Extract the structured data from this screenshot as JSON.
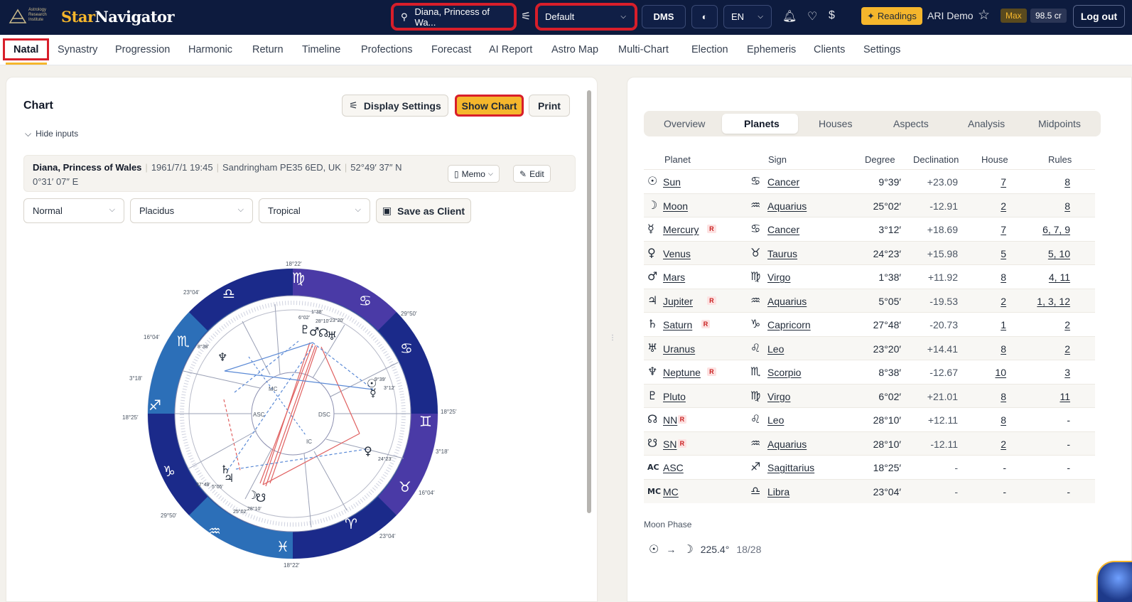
{
  "app": {
    "logo_small": "Astrology Research Institute",
    "logo_star": "Star",
    "logo_nav": "Navigator"
  },
  "topbar": {
    "profile_select": "Diana, Princess of Wa...",
    "preset_select": "Default",
    "format_button": "DMS",
    "language": "EN",
    "readings_label": "Readings",
    "user_name": "ARI Demo",
    "plan_badge": "Max",
    "credits": "98.5 cr",
    "logout_label": "Log out"
  },
  "nav": {
    "tabs": [
      "Natal",
      "Synastry",
      "Progression",
      "Harmonic",
      "Return",
      "Timeline",
      "Profections",
      "Forecast",
      "AI Report",
      "Astro Map",
      "Multi-Chart",
      "Election",
      "Ephemeris",
      "Clients",
      "Settings"
    ],
    "active": "Natal"
  },
  "chart_panel": {
    "title": "Chart",
    "display_settings": "Display Settings",
    "show_chart": "Show Chart",
    "print": "Print",
    "hide_inputs": "Hide inputs",
    "subject_name": "Diana, Princess of Wales",
    "datetime": "1961/7/1 19:45",
    "place": "Sandringham PE35 6ED, UK",
    "latitude": "52°49′ 37″ N",
    "longitude": "0°31′ 07″ E",
    "memo_label": "Memo",
    "edit_label": "Edit",
    "chart_type": "Normal",
    "house_system": "Placidus",
    "zodiac": "Tropical",
    "save_client": "Save as Client"
  },
  "wheel": {
    "labels": {
      "top": "18°22′",
      "bottom": "18°22′",
      "left": "18°25′",
      "right": "18°25′",
      "ul1": "23°04′",
      "ul2": "16°04′",
      "ul3": "3°18′",
      "ur1": "29°50′",
      "ur2": "3°18′",
      "ur3": "16°04′",
      "ll1": "29°50′",
      "lr1": "23°04′",
      "mc": "MC",
      "ic": "IC",
      "asc": "ASC",
      "dsc": "DSC"
    }
  },
  "details": {
    "tabs": [
      "Overview",
      "Planets",
      "Houses",
      "Aspects",
      "Analysis",
      "Midpoints"
    ],
    "active_tab": "Planets",
    "headers": {
      "planet": "Planet",
      "sign": "Sign",
      "degree": "Degree",
      "declination": "Declination",
      "house": "House",
      "rules": "Rules"
    },
    "rows": [
      {
        "glyph": "☉",
        "planet": "Sun",
        "retro": "",
        "sign_glyph": "♋",
        "sign": "Cancer",
        "degree": "9°39′",
        "decl": "+23.09",
        "house": "7",
        "rules": "8"
      },
      {
        "glyph": "☽",
        "planet": "Moon",
        "retro": "",
        "sign_glyph": "♒",
        "sign": "Aquarius",
        "degree": "25°02′",
        "decl": "-12.91",
        "house": "2",
        "rules": "8"
      },
      {
        "glyph": "☿",
        "planet": "Mercury",
        "retro": "R",
        "sign_glyph": "♋",
        "sign": "Cancer",
        "degree": "3°12′",
        "decl": "+18.69",
        "house": "7",
        "rules": "6, 7, 9"
      },
      {
        "glyph": "♀",
        "planet": "Venus",
        "retro": "",
        "sign_glyph": "♉",
        "sign": "Taurus",
        "degree": "24°23′",
        "decl": "+15.98",
        "house": "5",
        "rules": "5, 10"
      },
      {
        "glyph": "♂",
        "planet": "Mars",
        "retro": "",
        "sign_glyph": "♍",
        "sign": "Virgo",
        "degree": "1°38′",
        "decl": "+11.92",
        "house": "8",
        "rules": "4, 11"
      },
      {
        "glyph": "♃",
        "planet": "Jupiter",
        "retro": "R",
        "sign_glyph": "♒",
        "sign": "Aquarius",
        "degree": "5°05′",
        "decl": "-19.53",
        "house": "2",
        "rules": "1, 3, 12"
      },
      {
        "glyph": "♄",
        "planet": "Saturn",
        "retro": "R",
        "sign_glyph": "♑",
        "sign": "Capricorn",
        "degree": "27°48′",
        "decl": "-20.73",
        "house": "1",
        "rules": "2"
      },
      {
        "glyph": "♅",
        "planet": "Uranus",
        "retro": "",
        "sign_glyph": "♌",
        "sign": "Leo",
        "degree": "23°20′",
        "decl": "+14.41",
        "house": "8",
        "rules": "2"
      },
      {
        "glyph": "♆",
        "planet": "Neptune",
        "retro": "R",
        "sign_glyph": "♏",
        "sign": "Scorpio",
        "degree": "8°38′",
        "decl": "-12.67",
        "house": "10",
        "rules": "3"
      },
      {
        "glyph": "♇",
        "planet": "Pluto",
        "retro": "",
        "sign_glyph": "♍",
        "sign": "Virgo",
        "degree": "6°02′",
        "decl": "+21.01",
        "house": "8",
        "rules": "11"
      },
      {
        "glyph": "☊",
        "planet": "NN",
        "retro": "R",
        "sign_glyph": "♌",
        "sign": "Leo",
        "degree": "28°10′",
        "decl": "+12.11",
        "house": "8",
        "rules": "-"
      },
      {
        "glyph": "☋",
        "planet": "SN",
        "retro": "R",
        "sign_glyph": "♒",
        "sign": "Aquarius",
        "degree": "28°10′",
        "decl": "-12.11",
        "house": "2",
        "rules": "-"
      },
      {
        "glyph": "AC",
        "planet": "ASC",
        "retro": "",
        "sign_glyph": "♐",
        "sign": "Sagittarius",
        "degree": "18°25′",
        "decl": "-",
        "house": "-",
        "rules": "-"
      },
      {
        "glyph": "MC",
        "planet": "MC",
        "retro": "",
        "sign_glyph": "♎",
        "sign": "Libra",
        "degree": "23°04′",
        "decl": "-",
        "house": "-",
        "rules": "-"
      }
    ],
    "moon_phase_label": "Moon Phase",
    "moon_phase_angle": "225.4°",
    "moon_phase_day": "18/28"
  },
  "colors": {
    "brand_navy": "#0d1b3e",
    "accent_gold": "#f5b62c",
    "highlight_red": "#d81e2a"
  }
}
